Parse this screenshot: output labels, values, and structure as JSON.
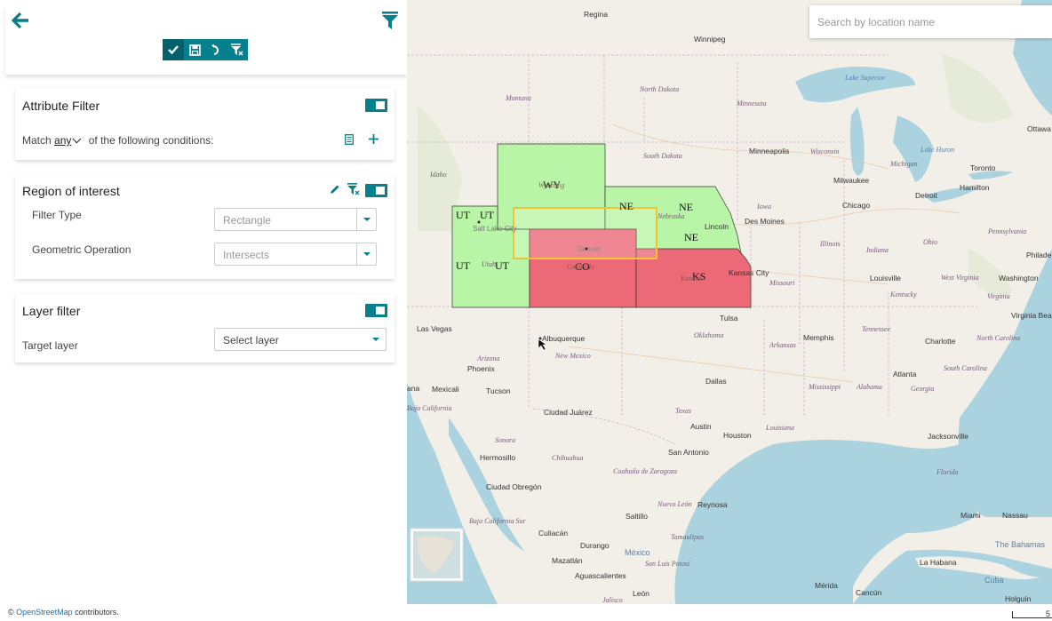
{
  "header": {
    "back_icon": "arrow-left-icon",
    "filter_icon": "funnel-icon",
    "toolbar": [
      {
        "name": "apply-filter-button",
        "icon": "check-icon"
      },
      {
        "name": "save-filter-button",
        "icon": "floppy-disk-icon"
      },
      {
        "name": "reset-filter-button",
        "icon": "undo-icon"
      },
      {
        "name": "clear-filter-button",
        "icon": "funnel-clear-icon"
      }
    ]
  },
  "attribute_filter": {
    "title": "Attribute Filter",
    "match_prefix": "Match",
    "match_value": "any",
    "match_suffix": "of the following conditions:"
  },
  "region_of_interest": {
    "title": "Region of interest",
    "filter_type_label": "Filter Type",
    "filter_type_value": "Rectangle",
    "geometric_operation_label": "Geometric Operation",
    "geometric_operation_value": "Intersects"
  },
  "layer_filter": {
    "title": "Layer filter",
    "target_layer_label": "Target layer",
    "target_layer_value": "Select layer"
  },
  "search": {
    "placeholder": "Search by location name"
  },
  "map": {
    "state_labels": [
      "WY",
      "UT",
      "UT",
      "UT",
      "UT",
      "NE",
      "NE",
      "CO",
      "KS"
    ],
    "place_labels": {
      "regina": "Regina",
      "winnipeg": "Winnipeg",
      "north_dakota": "North Dakota",
      "montana": "Montana",
      "minnesota": "Minnesota",
      "lake_superior": "Lake Superior",
      "south_dakota": "South Dakota",
      "minneapolis": "Minneapolis",
      "wisconsin": "Wisconsin",
      "michigan": "Michigan",
      "lake_huron": "Lake Huron",
      "toronto": "Toronto",
      "ottawa": "Ottawa",
      "idaho": "Idaho",
      "wyoming": "Wyoming",
      "milwaukee": "Milwaukee",
      "detroit": "Detroit",
      "hamilton": "Hamilton",
      "nebraska": "Nebraska",
      "iowa": "Iowa",
      "chicago": "Chicago",
      "des_moines": "Des Moines",
      "lincoln": "Lincoln",
      "salt_lake": "Salt Lake City",
      "utah": "Utah",
      "denver": "Denver",
      "colorado": "Colorado",
      "illinois": "Illinois",
      "indiana": "Indiana",
      "ohio": "Ohio",
      "pennsylvania": "Pennsylvania",
      "kansas": "Kansas",
      "kansas_city": "Kansas City",
      "missouri": "Missouri",
      "louisville": "Louisville",
      "west_virginia": "West Virginia",
      "washington": "Washington",
      "kentucky": "Kentucky",
      "virginia": "Virginia",
      "philadelphia": "Philade",
      "las_vegas": "Las Vegas",
      "tulsa": "Tulsa",
      "oklahoma": "Oklahoma",
      "memphis": "Memphis",
      "tennessee": "Tennessee",
      "charlotte": "Charlotte",
      "north_carolina": "North Carolina",
      "virginia_beach": "Virginia Bea",
      "albuquerque": "Albuquerque",
      "new_mexico": "New Mexico",
      "arkansas": "Arkansas",
      "arizona": "Arizona",
      "phoenix": "Phoenix",
      "south_carolina": "South Carolina",
      "atlanta": "Atlanta",
      "mississippi": "Mississippi",
      "alabama": "Alabama",
      "georgia": "Georgia",
      "dallas": "Dallas",
      "mexicali": "Mexicali",
      "tucson": "Tucson",
      "baja_california": "Baja California",
      "ciudad_juarez": "Ciudad Juárez",
      "texas": "Texas",
      "louisiana": "Louisiana",
      "austin": "Austin",
      "houston": "Houston",
      "jacksonville": "Jacksonville",
      "sonora": "Sonora",
      "hermosillo": "Hermosillo",
      "chihuahua": "Chihuahua",
      "san_antonio": "San Antonio",
      "coahuila": "Coahuila de Zaragoza",
      "florida": "Florida",
      "ciudad_obregon": "Ciudad Obregón",
      "nuevo_leon": "Nuevo León",
      "reynosa": "Reynosa",
      "baja_california_sur": "Baja California Sur",
      "saltillo": "Saltillo",
      "culiacan": "Culiacán",
      "durango": "Durango",
      "tamaulipas": "Tamaulipas",
      "miami": "Miami",
      "nassau": "Nassau",
      "bahamas": "The Bahamas",
      "mazatlan": "Mazatlán",
      "mexico": "México",
      "san_luis_potosi": "San Luis Potosí",
      "aguascalientes": "Aguascalientes",
      "la_habana": "La Habana",
      "cuba": "Cuba",
      "leon": "León",
      "jalisco": "Jalisco",
      "merida": "Mérida",
      "cancun": "Cancún",
      "holguin": "Holguín",
      "ana": "ana"
    },
    "fill_selected": "#b9f5a6",
    "fill_matched": "#ec6a77",
    "roi_color": "#f2c232"
  },
  "footer": {
    "attribution_link": "OpenStreetMap",
    "attribution_suffix": " contributors.",
    "copyright": "©",
    "scale_label": "5"
  }
}
